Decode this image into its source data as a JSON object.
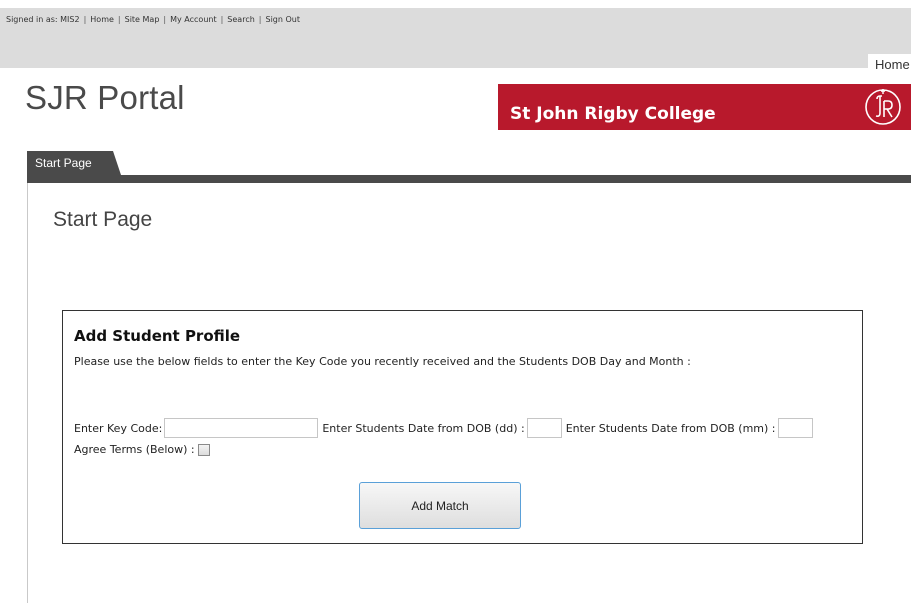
{
  "topbar": {
    "signed_in": "Signed in as: MIS2",
    "links": [
      "Home",
      "Site Map",
      "My Account",
      "Search",
      "Sign Out"
    ],
    "home_tab": "Home"
  },
  "header": {
    "portal_title": "SJR Portal",
    "college_name": "St John Rigby College",
    "brand_color": "#b8192c"
  },
  "tabs": {
    "start_tab": "Start Page"
  },
  "main": {
    "heading": "Start Page"
  },
  "form": {
    "title": "Add Student Profile",
    "description": "Please use the below fields to enter the Key Code you recently received and the Students DOB Day and Month :",
    "key_code_label": "Enter Key Code:",
    "key_code_value": "",
    "dob_day_label": "Enter Students Date from DOB (dd) :",
    "dob_day_value": "",
    "dob_month_label": "Enter Students Date from DOB (mm) :",
    "dob_month_value": "",
    "agree_label": "Agree Terms (Below) :",
    "agree_checked": false,
    "submit_label": "Add Match",
    "button_border_color": "#5aa0d8"
  }
}
